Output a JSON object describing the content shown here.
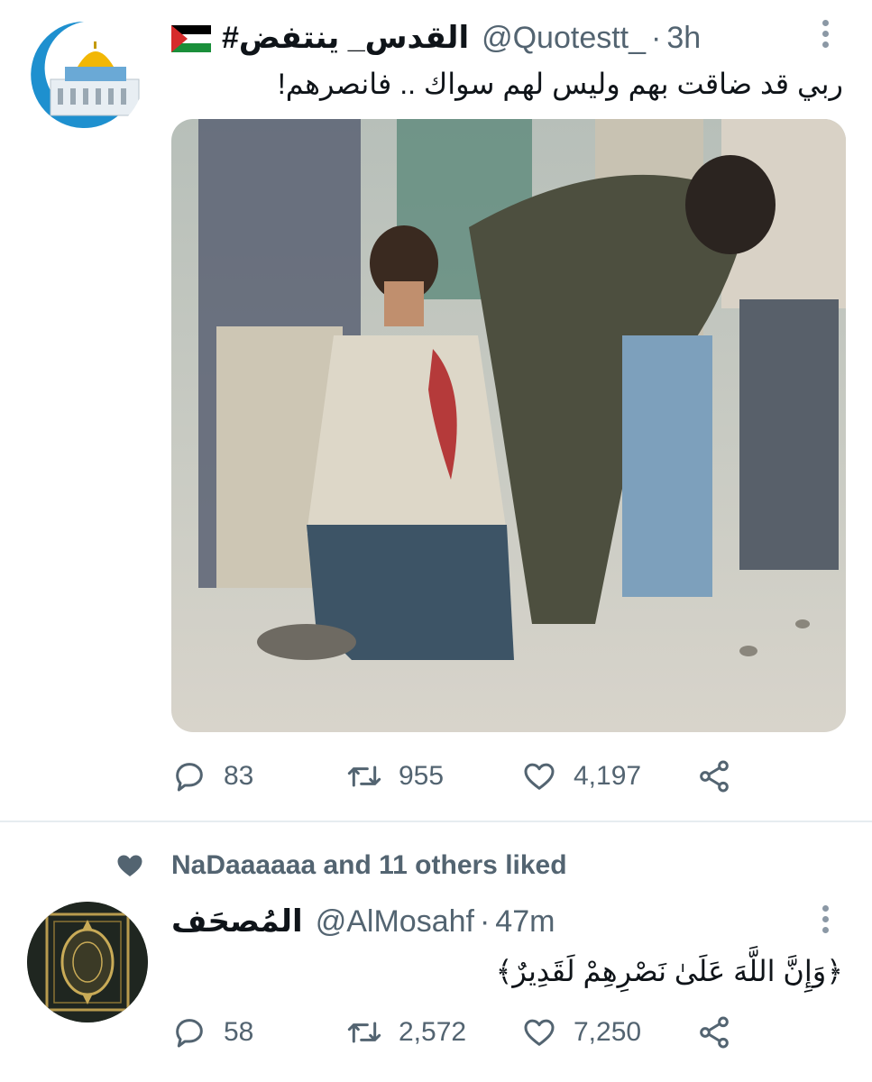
{
  "tweets": [
    {
      "display_name": "القدس_ ينتفض#",
      "flag": "palestine-flag",
      "handle": "@Quotestt_",
      "dot": "·",
      "time": "3h",
      "text": "ربي قد ضاقت بهم وليس لهم سواك .. فانصرهم!",
      "replies": "83",
      "retweets": "955",
      "likes": "4,197"
    },
    {
      "social_context": "NaDaaaaaa and 11 others liked",
      "display_name": "المُصحَف",
      "handle": "@AlMosahf",
      "dot": "·",
      "time": "47m",
      "text": "﴿وَإِنَّ اللَّهَ عَلَىٰ نَصْرِهِمْ لَقَدِيرٌ﴾",
      "replies": "58",
      "retweets": "2,572",
      "likes": "7,250"
    }
  ],
  "icons": {
    "reply": "reply-icon",
    "retweet": "retweet-icon",
    "like": "heart-icon",
    "share": "share-icon",
    "more": "more-options-icon",
    "social": "heart-filled-icon"
  },
  "colors": {
    "text": "#0f1419",
    "secondary": "#536471",
    "divider": "#e6ecf0",
    "avatar_ring": "#1e90cf"
  }
}
